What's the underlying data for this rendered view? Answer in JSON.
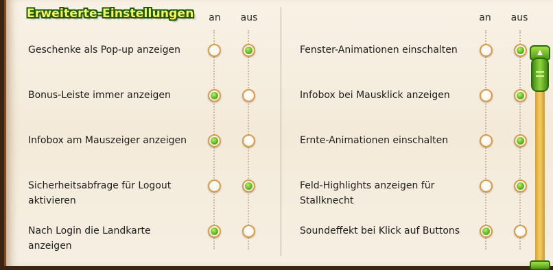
{
  "title": "Erweiterte-Einstellungen",
  "columns": {
    "on": "an",
    "off": "aus"
  },
  "left": [
    {
      "label": "Geschenke als Pop-up anzeigen",
      "value": "aus"
    },
    {
      "label": "Bonus-Leiste immer anzeigen",
      "value": "an"
    },
    {
      "label": "Infobox am Mauszeiger anzeigen",
      "value": "an"
    },
    {
      "label": "Sicherheitsabfrage für Logout aktivieren",
      "value": "aus"
    },
    {
      "label": "Nach Login die Landkarte anzeigen",
      "value": "an"
    }
  ],
  "right": [
    {
      "label": "Fenster-Animationen einschalten",
      "value": "aus"
    },
    {
      "label": "Infobox bei Mausklick anzeigen",
      "value": "aus"
    },
    {
      "label": "Ernte-Animationen einschalten",
      "value": "aus"
    },
    {
      "label": "Feld-Highlights anzeigen für Stallknecht",
      "value": "aus"
    },
    {
      "label": "Soundeffekt bei Klick auf Buttons",
      "value": "an"
    }
  ],
  "colors": {
    "accent": "#6fc22a",
    "radio_border": "#d79a45",
    "title_fill": "#fff35a",
    "title_outline": "#1f5a12"
  }
}
